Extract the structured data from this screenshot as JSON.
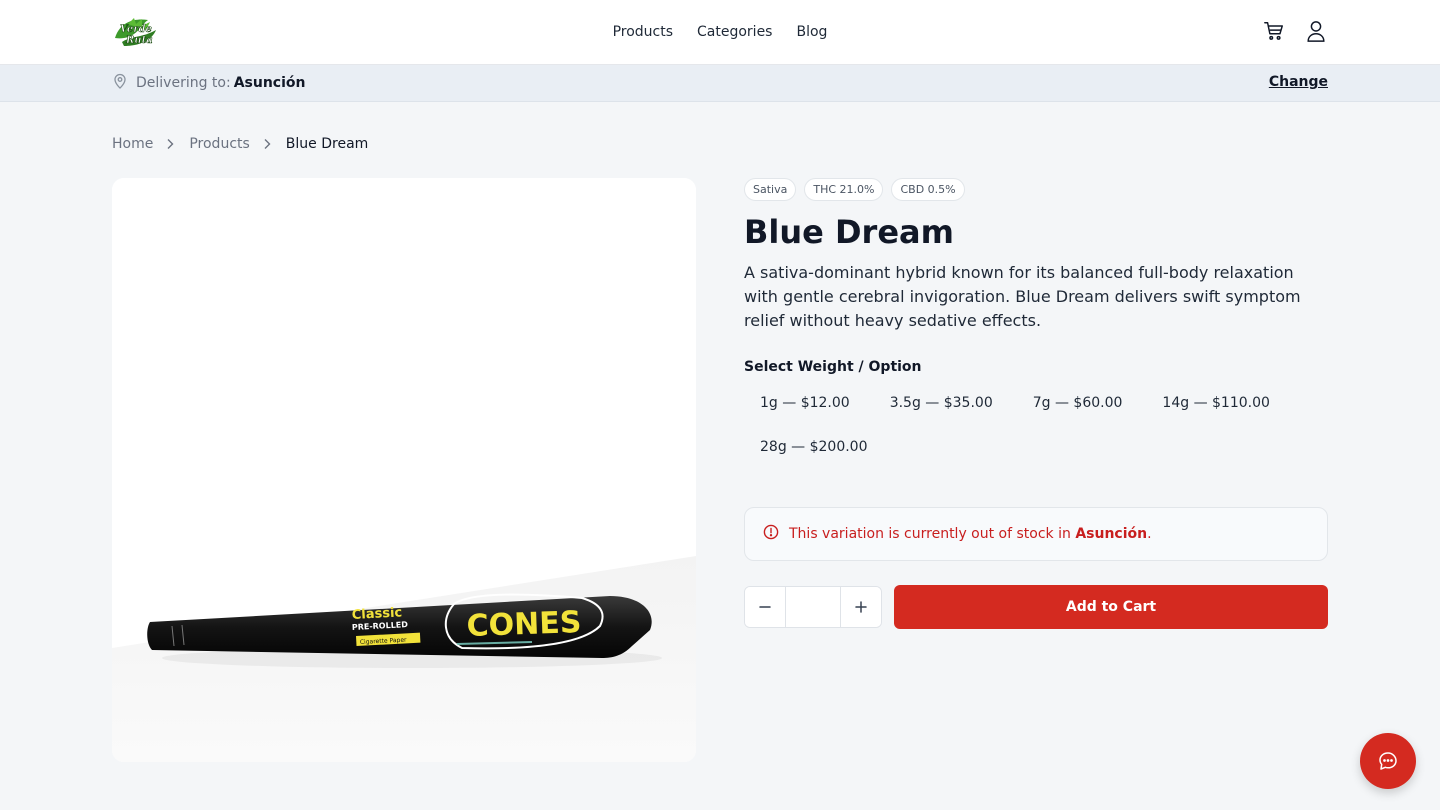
{
  "brand": {
    "logo_text_top": "Verde",
    "logo_text_bottom": "Ruta",
    "logo_icon": "leaf-logo"
  },
  "nav": {
    "items": [
      "Products",
      "Categories",
      "Blog"
    ]
  },
  "header_icons": [
    "cart-icon",
    "user-icon"
  ],
  "delivery": {
    "prefix": "Delivering to:",
    "city": "Asunción",
    "change_label": "Change",
    "icon": "map-pin-icon"
  },
  "breadcrumb": {
    "items": [
      "Home",
      "Products",
      "Blue Dream"
    ]
  },
  "product": {
    "image_label_classic": "Classic",
    "image_label_prerolled": "PRE-ROLLED",
    "image_label_paper": "Cigarette Paper",
    "image_label_brand": "CONES",
    "tags": [
      "Sativa",
      "THC 21.0%",
      "CBD 0.5%"
    ],
    "name": "Blue Dream",
    "description": "A sativa-dominant hybrid known for its balanced full-body relaxation with gentle cerebral invigoration. Blue Dream delivers swift symptom relief without heavy sedative effects.",
    "select_label": "Select Weight / Option",
    "options": [
      "1g — $12.00",
      "3.5g — $35.00",
      "7g — $60.00",
      "14g — $110.00",
      "28g — $200.00"
    ]
  },
  "stock_alert": {
    "text_before": "This variation is currently out of stock in ",
    "city": "Asunción",
    "text_after": ".",
    "icon": "alert-circle-icon",
    "color": "#c81e1e"
  },
  "quantity": {
    "value": ""
  },
  "add_to_cart_label": "Add to Cart",
  "chat_icon": "chat-bubble-icon",
  "colors": {
    "accent": "#d42a20",
    "background": "#f4f6f8",
    "delivery_bar": "#e9eef4"
  }
}
